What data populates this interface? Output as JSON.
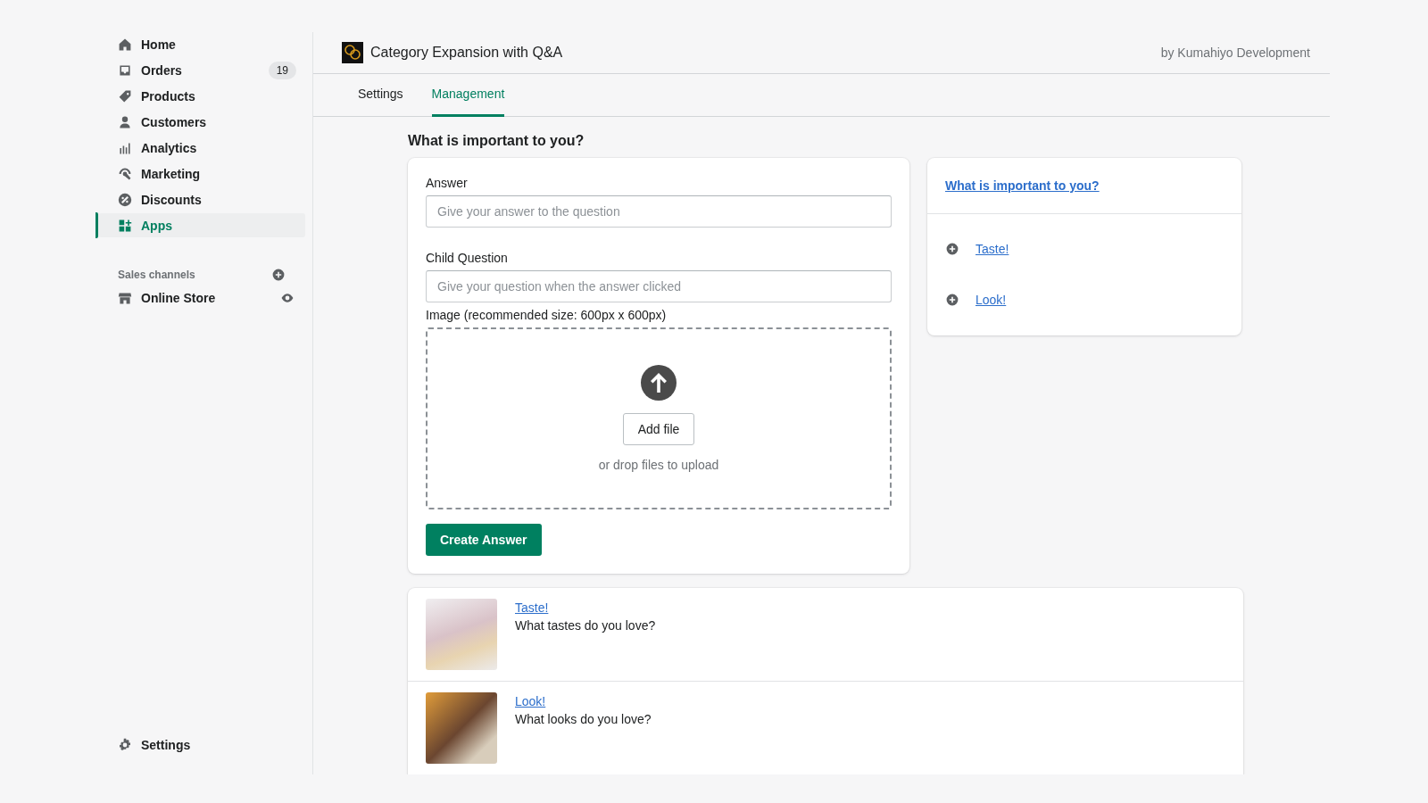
{
  "sidebar": {
    "items": [
      {
        "label": "Home",
        "selected": false
      },
      {
        "label": "Orders",
        "badge": "19",
        "selected": false
      },
      {
        "label": "Products",
        "selected": false
      },
      {
        "label": "Customers",
        "selected": false
      },
      {
        "label": "Analytics",
        "selected": false
      },
      {
        "label": "Marketing",
        "selected": false
      },
      {
        "label": "Discounts",
        "selected": false
      },
      {
        "label": "Apps",
        "selected": true
      }
    ],
    "sales_channels": {
      "title": "Sales channels",
      "items": [
        {
          "label": "Online Store"
        }
      ]
    },
    "settings": "Settings"
  },
  "app_header": {
    "title": "Category Expansion with Q&A",
    "developer": "by Kumahiyo Development"
  },
  "tabs": [
    {
      "label": "Settings",
      "selected": false
    },
    {
      "label": "Management",
      "selected": true
    }
  ],
  "heading": "What is important to you?",
  "form": {
    "answer": {
      "label": "Answer",
      "placeholder": "Give your answer to the question"
    },
    "child_question": {
      "label": "Child Question",
      "placeholder": "Give your question when the answer clicked"
    },
    "image": {
      "label": "Image (recommended size: 600px x 600px)",
      "button": "Add file",
      "hint": "or drop files to upload"
    },
    "submit": "Create Answer"
  },
  "tree": {
    "root": "What is important to you?",
    "children": [
      {
        "label": "Taste!"
      },
      {
        "label": "Look!"
      }
    ]
  },
  "answers": [
    {
      "title": "Taste!",
      "question": "What tastes do you love?"
    },
    {
      "title": "Look!",
      "question": "What looks do you love?"
    }
  ]
}
